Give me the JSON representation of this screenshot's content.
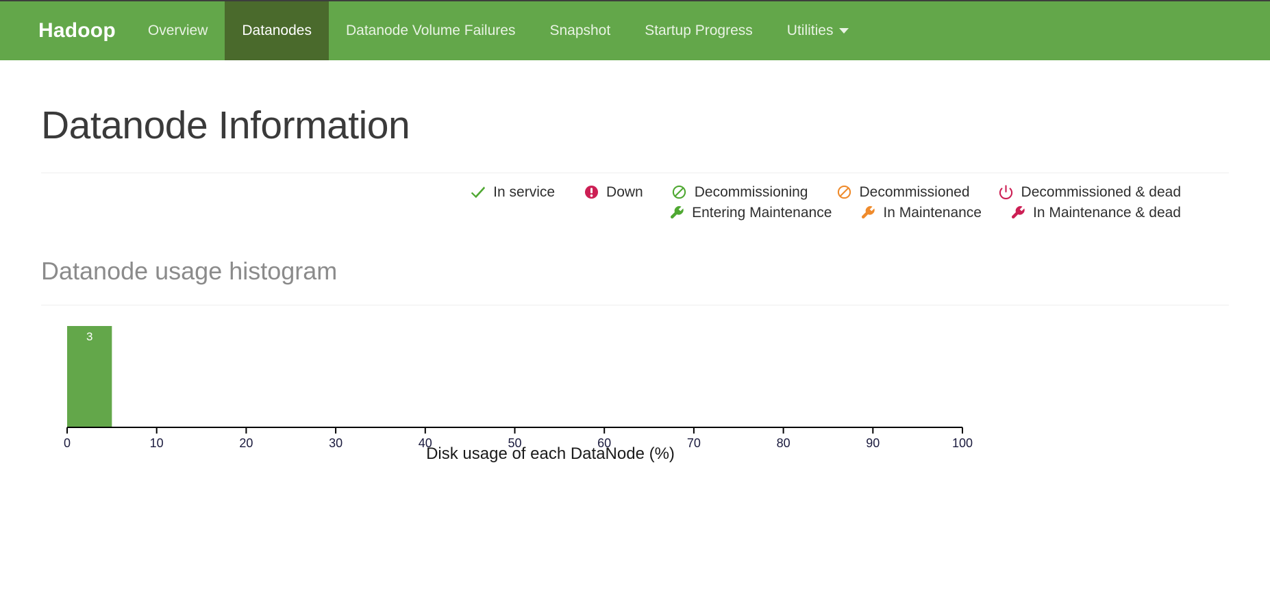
{
  "navbar": {
    "brand": "Hadoop",
    "items": [
      {
        "label": "Overview",
        "active": false,
        "icon": ""
      },
      {
        "label": "Datanodes",
        "active": true,
        "icon": ""
      },
      {
        "label": "Datanode Volume Failures",
        "active": false,
        "icon": ""
      },
      {
        "label": "Snapshot",
        "active": false,
        "icon": ""
      },
      {
        "label": "Startup Progress",
        "active": false,
        "icon": ""
      },
      {
        "label": "Utilities",
        "active": false,
        "icon": "caret-down-icon"
      }
    ],
    "background_color": "#63a74a",
    "active_color": "#4a6a2c"
  },
  "page": {
    "title": "Datanode Information"
  },
  "legend": {
    "rows": [
      [
        {
          "label": "In service",
          "icon": "check-icon",
          "color": "#4fa832"
        },
        {
          "label": "Down",
          "icon": "exclamation-circle-icon",
          "color": "#cc1f54"
        },
        {
          "label": "Decommissioning",
          "icon": "ban-icon",
          "color": "#4fa832"
        },
        {
          "label": "Decommissioned",
          "icon": "ban-icon",
          "color": "#ef8b2c"
        },
        {
          "label": "Decommissioned & dead",
          "icon": "power-off-icon",
          "color": "#cc1f54"
        }
      ],
      [
        {
          "label": "Entering Maintenance",
          "icon": "wrench-icon",
          "color": "#4fa832"
        },
        {
          "label": "In Maintenance",
          "icon": "wrench-icon",
          "color": "#ef8b2c"
        },
        {
          "label": "In Maintenance & dead",
          "icon": "wrench-icon",
          "color": "#cc1f54"
        }
      ]
    ]
  },
  "histogram": {
    "heading": "Datanode usage histogram"
  },
  "chart_data": {
    "type": "bar",
    "title": "Datanode usage histogram",
    "xlabel": "Disk usage of each DataNode (%)",
    "ylabel": "",
    "xlim": [
      0,
      100
    ],
    "ylim": [
      0,
      3
    ],
    "grid": false,
    "legend_position": "none",
    "bin_width": 5,
    "bar_color": "#63a74a",
    "label_color": "#ffffff",
    "axis_color": "#000000",
    "tick_labels": [
      "0",
      "10",
      "20",
      "30",
      "40",
      "50",
      "60",
      "70",
      "80",
      "90",
      "100"
    ],
    "ticks": [
      0,
      10,
      20,
      30,
      40,
      50,
      60,
      70,
      80,
      90,
      100
    ],
    "bins": [
      {
        "x0": 0,
        "x1": 5,
        "count": 3,
        "label": "3"
      }
    ],
    "categories": [
      "0-5"
    ],
    "values": [
      3
    ],
    "data_labels": [
      "3"
    ]
  }
}
